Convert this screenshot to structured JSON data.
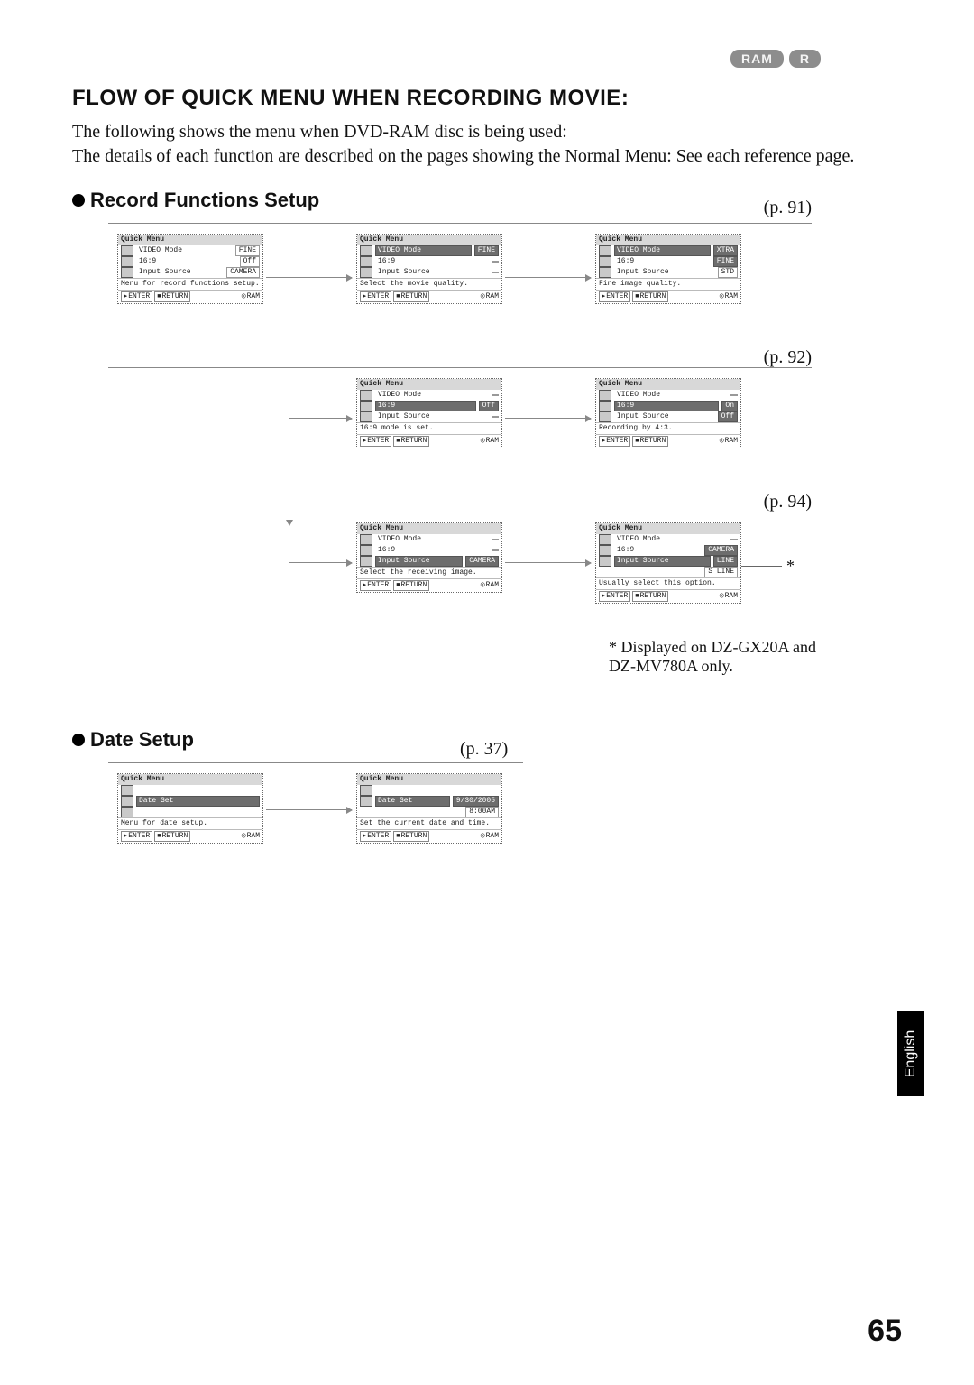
{
  "badges": {
    "ram": "RAM",
    "r": "R"
  },
  "title": "FLOW OF QUICK MENU WHEN RECORDING MOVIE:",
  "intro": "The following shows the menu when DVD-RAM disc is being used:\nThe details of each function are described on the pages showing the Normal Menu: See each reference page.",
  "section1": "Record Functions Setup",
  "section2": "Date Setup",
  "page_refs": {
    "p91": "(p. 91)",
    "p92": "(p. 92)",
    "p94": "(p. 94)",
    "p37": "(p. 37)"
  },
  "star": "*",
  "star_note": "Displayed on DZ-GX20A and DZ-MV780A only.",
  "lang": "English",
  "page_number": "65",
  "menu_common": {
    "title": "Quick Menu",
    "enter": "ENTER",
    "return": "RETURN",
    "disc": "RAM",
    "play_sym": "▶",
    "stop_sym": "■",
    "disc_sym": "◎"
  },
  "rows": {
    "video_mode": "VIDEO Mode",
    "r169": "16:9",
    "input_src": "Input Source"
  },
  "vals": {
    "fine": "FINE",
    "xtra": "XTRA",
    "std": "STD",
    "off": "Off",
    "on": "On",
    "camera": "CAMERA",
    "line": "LINE",
    "sline": "S LINE",
    "blank": ""
  },
  "hints": {
    "m1": "Menu for record functions setup.",
    "m2": "Select the movie quality.",
    "m3": "Fine image quality.",
    "m4": "16:9 mode is set.",
    "m5": "Recording by 4:3.",
    "m6": "Select the receiving image.",
    "m7": "Usually select this option.",
    "d1": "Menu for date setup.",
    "d2": "Set the current date and time."
  },
  "date": {
    "row_label": "Date Set",
    "value_date": "9/30/2005",
    "value_time": "8:00AM"
  }
}
